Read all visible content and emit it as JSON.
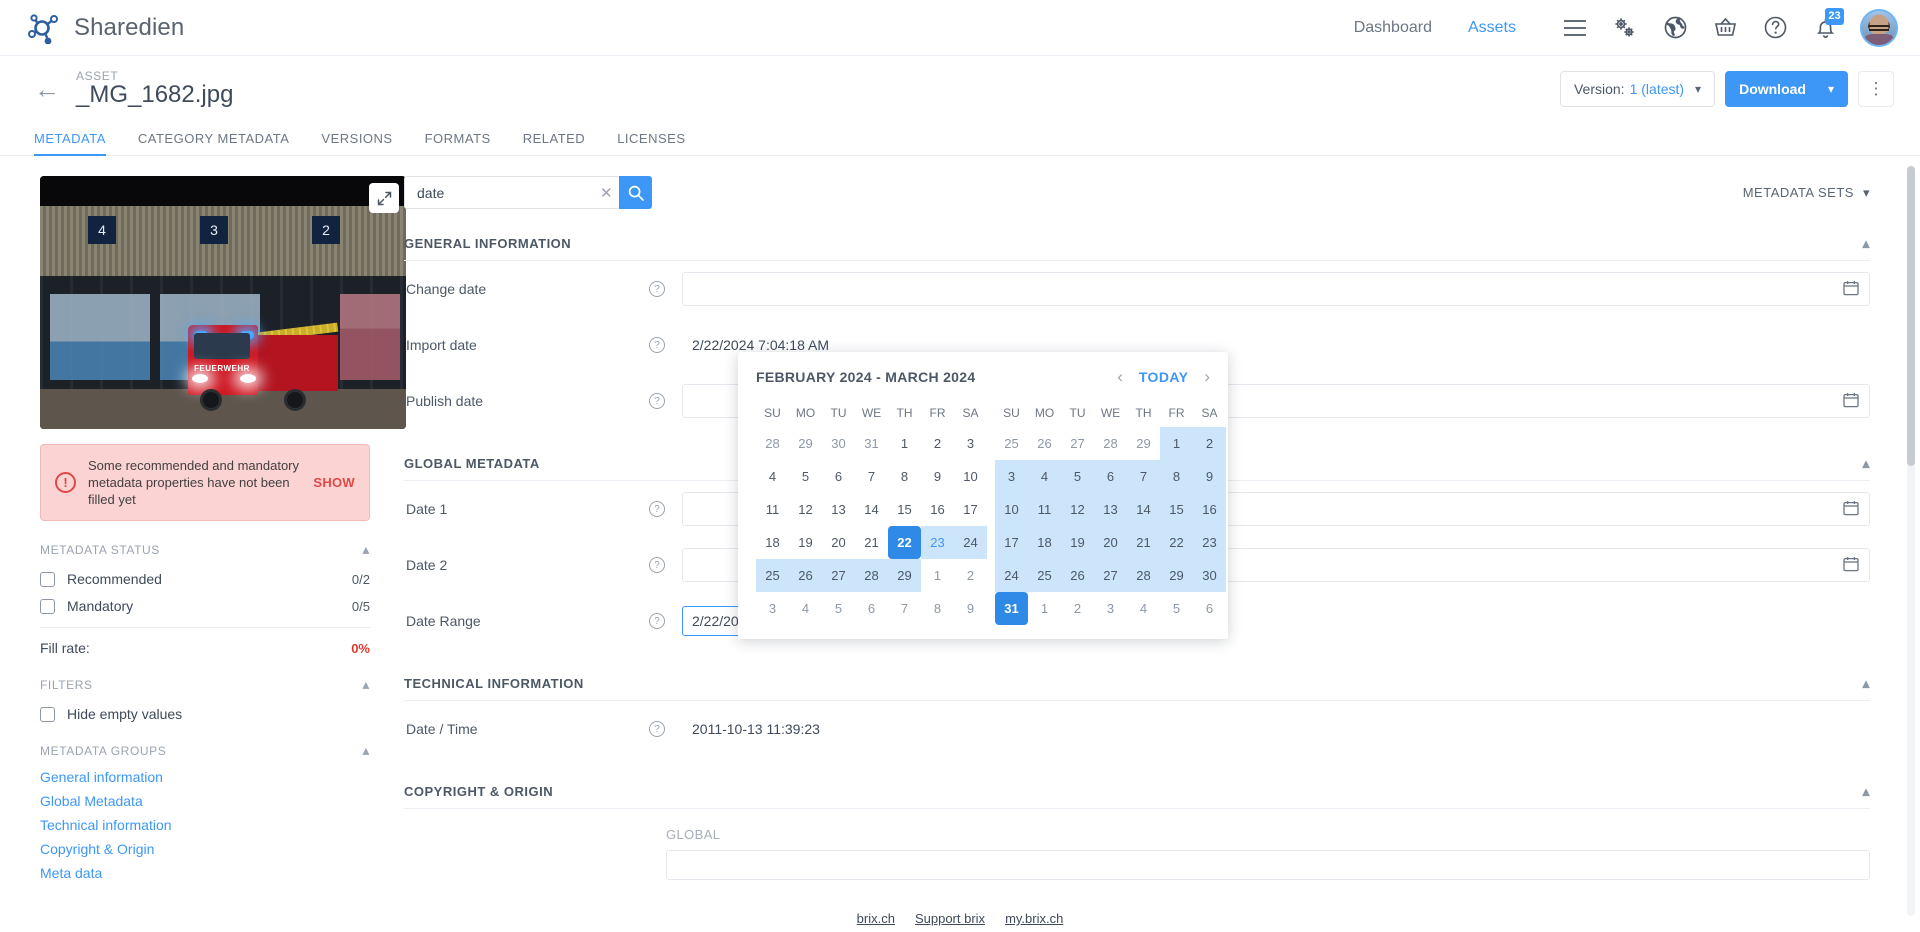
{
  "topbar": {
    "brand": "Sharedien",
    "nav": [
      {
        "label": "Dashboard",
        "active": false
      },
      {
        "label": "Assets",
        "active": true
      }
    ],
    "icons": [
      "menu-icon",
      "gears-icon",
      "globe-icon",
      "basket-icon",
      "help-icon",
      "bell-icon"
    ],
    "notification_count": "23"
  },
  "asset_header": {
    "kicker": "ASSET",
    "title": "_MG_1682.jpg",
    "version_prefix": "Version:",
    "version_value": "1 (latest)",
    "download_label": "Download"
  },
  "tabs": [
    {
      "label": "METADATA",
      "active": true
    },
    {
      "label": "CATEGORY METADATA",
      "active": false
    },
    {
      "label": "VERSIONS",
      "active": false
    },
    {
      "label": "FORMATS",
      "active": false
    },
    {
      "label": "RELATED",
      "active": false
    },
    {
      "label": "LICENSES",
      "active": false
    }
  ],
  "sidebar": {
    "preview_numbers": [
      "4",
      "3",
      "2"
    ],
    "preview_truck_text": "FEUERWEHR",
    "alert": {
      "message": "Some recommended and mandatory metadata properties have not been filled yet",
      "action": "SHOW"
    },
    "metadata_status": {
      "title": "METADATA STATUS",
      "items": [
        {
          "label": "Recommended",
          "count": "0/2"
        },
        {
          "label": "Mandatory",
          "count": "0/5"
        }
      ],
      "fill_rate_label": "Fill rate:",
      "fill_rate_value": "0%"
    },
    "filters": {
      "title": "FILTERS",
      "items": [
        {
          "label": "Hide empty values"
        }
      ]
    },
    "metadata_groups": {
      "title": "METADATA GROUPS",
      "links": [
        "General information",
        "Global Metadata",
        "Technical information",
        "Copyright & Origin",
        "Meta data"
      ]
    }
  },
  "main": {
    "search": {
      "value": "date",
      "placeholder": ""
    },
    "metadata_sets_label": "METADATA SETS",
    "sections": [
      {
        "title": "GENERAL INFORMATION",
        "fields": [
          {
            "label": "Change date",
            "value": "",
            "type": "date"
          },
          {
            "label": "Import date",
            "value": "2/22/2024 7:04:18 AM",
            "type": "text"
          },
          {
            "label": "Publish date",
            "value": "",
            "type": "date"
          }
        ]
      },
      {
        "title": "GLOBAL METADATA",
        "fields": [
          {
            "label": "Date 1",
            "value": "",
            "type": "date"
          },
          {
            "label": "Date 2",
            "value": "",
            "type": "date"
          },
          {
            "label": "Date Range",
            "value": "",
            "type": "range"
          }
        ]
      },
      {
        "title": "TECHNICAL INFORMATION",
        "fields": [
          {
            "label": "Date / Time",
            "value": "2011-10-13 11:39:23",
            "type": "readonly"
          }
        ]
      },
      {
        "title": "COPYRIGHT & ORIGIN",
        "fields": [],
        "global_label": "GLOBAL"
      }
    ],
    "date_range": {
      "start": "2/22/2024",
      "end": "3/31/2024",
      "separator": "-"
    }
  },
  "calendar": {
    "title": "FEBRUARY 2024 - MARCH 2024",
    "today_label": "TODAY",
    "prev_icon": "chevron-left-icon",
    "next_icon": "chevron-right-icon",
    "dow": [
      "SU",
      "MO",
      "TU",
      "WE",
      "TH",
      "FR",
      "SA"
    ],
    "left_month": {
      "name": "FEBRUARY 2024",
      "weeks": [
        [
          {
            "d": "28",
            "m": true
          },
          {
            "d": "29",
            "m": true
          },
          {
            "d": "30",
            "m": true
          },
          {
            "d": "31",
            "m": true
          },
          {
            "d": "1"
          },
          {
            "d": "2"
          },
          {
            "d": "3"
          }
        ],
        [
          {
            "d": "4"
          },
          {
            "d": "5"
          },
          {
            "d": "6"
          },
          {
            "d": "7"
          },
          {
            "d": "8"
          },
          {
            "d": "9"
          },
          {
            "d": "10"
          }
        ],
        [
          {
            "d": "11"
          },
          {
            "d": "12"
          },
          {
            "d": "13"
          },
          {
            "d": "14"
          },
          {
            "d": "15"
          },
          {
            "d": "16"
          },
          {
            "d": "17"
          }
        ],
        [
          {
            "d": "18"
          },
          {
            "d": "19"
          },
          {
            "d": "20"
          },
          {
            "d": "21"
          },
          {
            "d": "22",
            "sel": true
          },
          {
            "d": "23",
            "range": true,
            "today": true
          },
          {
            "d": "24",
            "range": true
          }
        ],
        [
          {
            "d": "25",
            "range": true
          },
          {
            "d": "26",
            "range": true
          },
          {
            "d": "27",
            "range": true
          },
          {
            "d": "28",
            "range": true
          },
          {
            "d": "29",
            "range": true
          },
          {
            "d": "1",
            "m": true
          },
          {
            "d": "2",
            "m": true
          }
        ],
        [
          {
            "d": "3",
            "m": true
          },
          {
            "d": "4",
            "m": true
          },
          {
            "d": "5",
            "m": true
          },
          {
            "d": "6",
            "m": true
          },
          {
            "d": "7",
            "m": true
          },
          {
            "d": "8",
            "m": true
          },
          {
            "d": "9",
            "m": true
          }
        ]
      ]
    },
    "right_month": {
      "name": "MARCH 2024",
      "weeks": [
        [
          {
            "d": "25",
            "m": true
          },
          {
            "d": "26",
            "m": true
          },
          {
            "d": "27",
            "m": true
          },
          {
            "d": "28",
            "m": true
          },
          {
            "d": "29",
            "m": true
          },
          {
            "d": "1",
            "range": true
          },
          {
            "d": "2",
            "range": true
          }
        ],
        [
          {
            "d": "3",
            "range": true
          },
          {
            "d": "4",
            "range": true
          },
          {
            "d": "5",
            "range": true
          },
          {
            "d": "6",
            "range": true
          },
          {
            "d": "7",
            "range": true
          },
          {
            "d": "8",
            "range": true
          },
          {
            "d": "9",
            "range": true
          }
        ],
        [
          {
            "d": "10",
            "range": true
          },
          {
            "d": "11",
            "range": true
          },
          {
            "d": "12",
            "range": true
          },
          {
            "d": "13",
            "range": true
          },
          {
            "d": "14",
            "range": true
          },
          {
            "d": "15",
            "range": true
          },
          {
            "d": "16",
            "range": true
          }
        ],
        [
          {
            "d": "17",
            "range": true
          },
          {
            "d": "18",
            "range": true
          },
          {
            "d": "19",
            "range": true
          },
          {
            "d": "20",
            "range": true
          },
          {
            "d": "21",
            "range": true
          },
          {
            "d": "22",
            "range": true
          },
          {
            "d": "23",
            "range": true
          }
        ],
        [
          {
            "d": "24",
            "range": true
          },
          {
            "d": "25",
            "range": true
          },
          {
            "d": "26",
            "range": true
          },
          {
            "d": "27",
            "range": true
          },
          {
            "d": "28",
            "range": true
          },
          {
            "d": "29",
            "range": true
          },
          {
            "d": "30",
            "range": true
          }
        ],
        [
          {
            "d": "31",
            "sel": true
          },
          {
            "d": "1",
            "m": true
          },
          {
            "d": "2",
            "m": true
          },
          {
            "d": "3",
            "m": true
          },
          {
            "d": "4",
            "m": true
          },
          {
            "d": "5",
            "m": true
          },
          {
            "d": "6",
            "m": true
          }
        ]
      ]
    }
  },
  "footer": {
    "links": [
      "brix.ch",
      "Support brix",
      "my.brix.ch"
    ]
  },
  "colors": {
    "accent": "#3d97f7",
    "range": "#cde5fb",
    "selected": "#2e8ae6",
    "danger": "#e04848",
    "text": "#3f4a5a"
  }
}
